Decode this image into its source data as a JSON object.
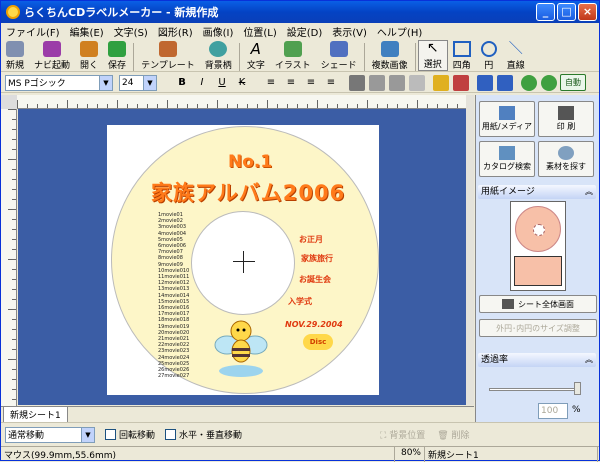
{
  "window": {
    "title": "らくちんCDラベルメーカー - 新規作成",
    "min": "_",
    "max": "□",
    "close": "×"
  },
  "menu": [
    "ファイル(F)",
    "編集(E)",
    "文字(S)",
    "図形(R)",
    "画像(I)",
    "位置(L)",
    "設定(D)",
    "表示(V)",
    "ヘルプ(H)"
  ],
  "toolbar": [
    {
      "label": "新規",
      "icon": "new-doc-icon",
      "color": "#8090b0"
    },
    {
      "label": "ナビ起動",
      "icon": "navi-icon",
      "color": "#9b3ca8"
    },
    {
      "label": "開く",
      "icon": "open-icon",
      "color": "#d08020"
    },
    {
      "label": "保存",
      "icon": "save-icon",
      "color": "#30a040"
    },
    {
      "label": "テンプレート",
      "icon": "template-icon",
      "color": "#c06830"
    },
    {
      "label": "背景柄",
      "icon": "background-icon",
      "color": "#40a0a0"
    },
    {
      "label": "文字",
      "icon": "text-icon",
      "color": "#333333"
    },
    {
      "label": "イラスト",
      "icon": "illustration-icon",
      "color": "#50a050"
    },
    {
      "label": "シェード",
      "icon": "shade-icon",
      "color": "#5070c0"
    },
    {
      "label": "複数画像",
      "icon": "multi-image-icon",
      "color": "#4080c0"
    },
    {
      "label": "選択",
      "icon": "select-arrow-icon",
      "color": "#555555"
    },
    {
      "label": "四角",
      "icon": "rectangle-icon",
      "color": "#2060c0"
    },
    {
      "label": "円",
      "icon": "circle-icon",
      "color": "#2060c0"
    },
    {
      "label": "直線",
      "icon": "line-icon",
      "color": "#2060c0"
    }
  ],
  "format": {
    "font": "MS Pゴシック",
    "size": "24",
    "bold": "B",
    "italic": "I",
    "underline": "U",
    "strike": "K",
    "zoom_auto": "自動"
  },
  "disc": {
    "title1": "No.1",
    "title2": "家族アルバム2006",
    "tracks": [
      "1movie01",
      "2movie02",
      "3movie003",
      "4movie004",
      "5movie05",
      "6movie006",
      "7movie07",
      "8movie08",
      "9movie09",
      "10movie010",
      "11movie011",
      "12movie012",
      "13movie013",
      "14movie014",
      "15movie015",
      "16movie016",
      "17movie017",
      "18movie018",
      "19movie019",
      "20movie020",
      "21movie021",
      "22movie022",
      "23movie023",
      "24movie024",
      "25movie025",
      "26movie026",
      "27movie027"
    ],
    "events": [
      "お正月",
      "家族旅行",
      "お誕生会",
      "入学式"
    ],
    "date": "NOV.29.2004",
    "logo": "Disc"
  },
  "tabs": {
    "sheet1": "新規シート1"
  },
  "bottom": {
    "move_mode": "通常移動",
    "rotate_move": "回転移動",
    "hv_move": "水平・垂直移動",
    "bg_position": "背景位置",
    "delete": "削除"
  },
  "status": {
    "mouse": "マウス(99.9mm,55.6mm)",
    "zoom": "80%",
    "sheet": "新規シート1"
  },
  "panel": {
    "btn_paper": "用紙/メディア",
    "btn_print": "印 刷",
    "btn_catalog": "カタログ検索",
    "btn_search": "素材を探す",
    "paper_image": "用紙イメージ",
    "whole_sheet": "シート全体画面",
    "size_adjust": "外円･内円のサイズ調整",
    "transparency": "透過率",
    "transparency_value": "100",
    "percent": "%"
  }
}
